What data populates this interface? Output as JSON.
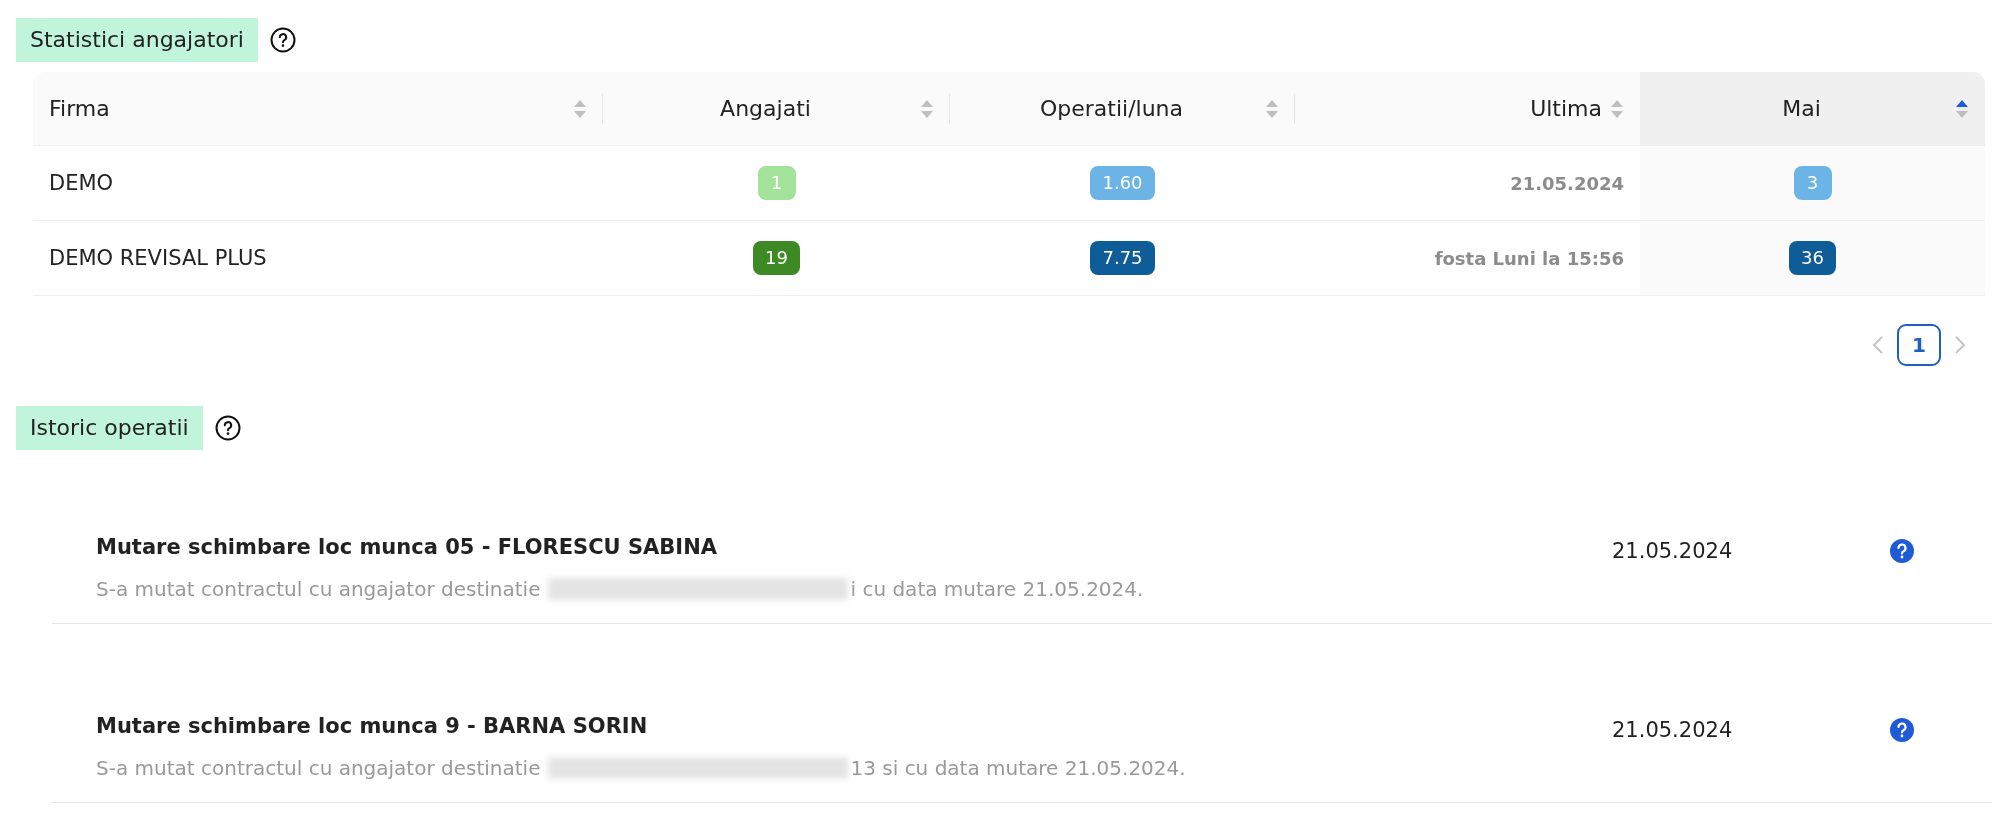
{
  "stats": {
    "title": "Statistici angajatori",
    "table": {
      "columns": [
        {
          "label": "Firma",
          "sorted": false
        },
        {
          "label": "Angajati",
          "sorted": false
        },
        {
          "label": "Operatii/luna",
          "sorted": false
        },
        {
          "label": "Ultima",
          "sorted": false
        },
        {
          "label": "Mai",
          "sorted": true
        }
      ],
      "rows": [
        {
          "firma": "DEMO",
          "angajati": {
            "text": "1",
            "color": "#a3e29a"
          },
          "operatii": {
            "text": "1.60",
            "color": "#6cb4e6"
          },
          "ultima": "21.05.2024",
          "mai": {
            "text": "3",
            "color": "#6cb4e6"
          }
        },
        {
          "firma": "DEMO REVISAL PLUS",
          "angajati": {
            "text": "19",
            "color": "#3d8a24"
          },
          "operatii": {
            "text": "7.75",
            "color": "#0f5d98"
          },
          "ultima": "fosta Luni la 15:56",
          "mai": {
            "text": "36",
            "color": "#0f5d98"
          }
        }
      ]
    },
    "pagination": {
      "pages": [
        {
          "label": "1",
          "selected": true
        }
      ]
    }
  },
  "history": {
    "title": "Istoric operatii",
    "items": [
      {
        "title": "Mutare schimbare loc munca 05 - FLORESCU SABINA",
        "text_before": "S-a mutat contractul cu angajator destinatie",
        "redacted": true,
        "text_after": "i cu data mutare 21.05.2024.",
        "date": "21.05.2024"
      },
      {
        "title": "Mutare schimbare loc munca 9 - BARNA SORIN",
        "text_before": "S-a mutat contractul cu angajator destinatie",
        "redacted": true,
        "text_after": "13 si cu data mutare 21.05.2024.",
        "date": "21.05.2024"
      }
    ]
  }
}
